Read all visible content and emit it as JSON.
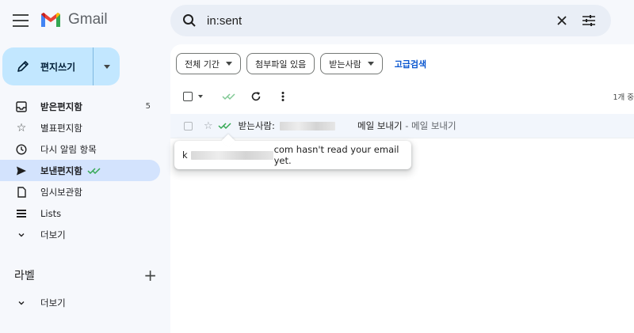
{
  "app": {
    "name": "Gmail"
  },
  "compose": {
    "label": "편지쓰기"
  },
  "nav": [
    {
      "label": "받은편지함",
      "count": "5",
      "icon": "inbox-icon",
      "bold": true
    },
    {
      "label": "별표편지함",
      "count": "",
      "icon": "star-icon"
    },
    {
      "label": "다시 알림 항목",
      "count": "",
      "icon": "clock-icon"
    },
    {
      "label": "보낸편지함",
      "count": "",
      "icon": "send-icon",
      "active": true
    },
    {
      "label": "임시보관함",
      "count": "",
      "icon": "draft-icon"
    },
    {
      "label": "Lists",
      "count": "",
      "icon": "list-icon"
    },
    {
      "label": "더보기",
      "count": "",
      "icon": "chevron-down-icon"
    }
  ],
  "labels": {
    "title": "라벨",
    "more": "더보기"
  },
  "search": {
    "value": "in:sent"
  },
  "filters": [
    {
      "label": "전체 기간"
    },
    {
      "label": "첨부파일 있음"
    },
    {
      "label": "받는사람"
    }
  ],
  "advanced_search": "고급검색",
  "toolbar": {
    "count_text": "1개 중"
  },
  "email_row": {
    "recipient_prefix": "받는사람:",
    "subject": "메일 보내기",
    "snippet": " - 메일 보내기"
  },
  "tooltip": {
    "prefix": "k",
    "suffix": "com hasn't read your email yet."
  },
  "colors": {
    "accent": "#0b57d0",
    "compose_bg": "#c2e7ff",
    "active_nav": "#d3e3fd",
    "tracker_check": "#34a853"
  }
}
